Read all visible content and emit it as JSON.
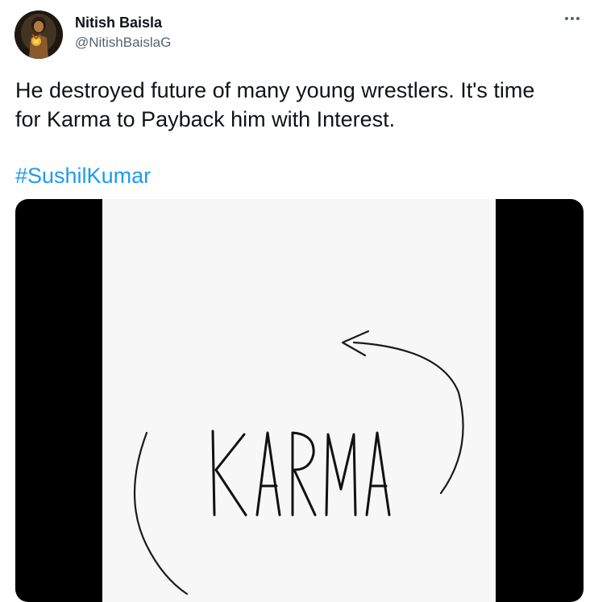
{
  "tweet": {
    "author": {
      "display_name": "Nitish Baisla",
      "handle": "@NitishBaislaG",
      "avatar_icon": "user-avatar"
    },
    "more_icon": "more-horizontal-icon",
    "text": "He destroyed future of many young wrestlers. It's time\nfor Karma to Payback him with Interest.",
    "hashtag": "#SushilKumar",
    "media": {
      "word": "KARMA",
      "kind": "hand-drawn karma cycle illustration"
    }
  },
  "colors": {
    "text_primary": "#0f1419",
    "text_secondary": "#536471",
    "link": "#1d9bf0",
    "media_letterbox": "#000000",
    "media_background": "#f7f7f7"
  }
}
